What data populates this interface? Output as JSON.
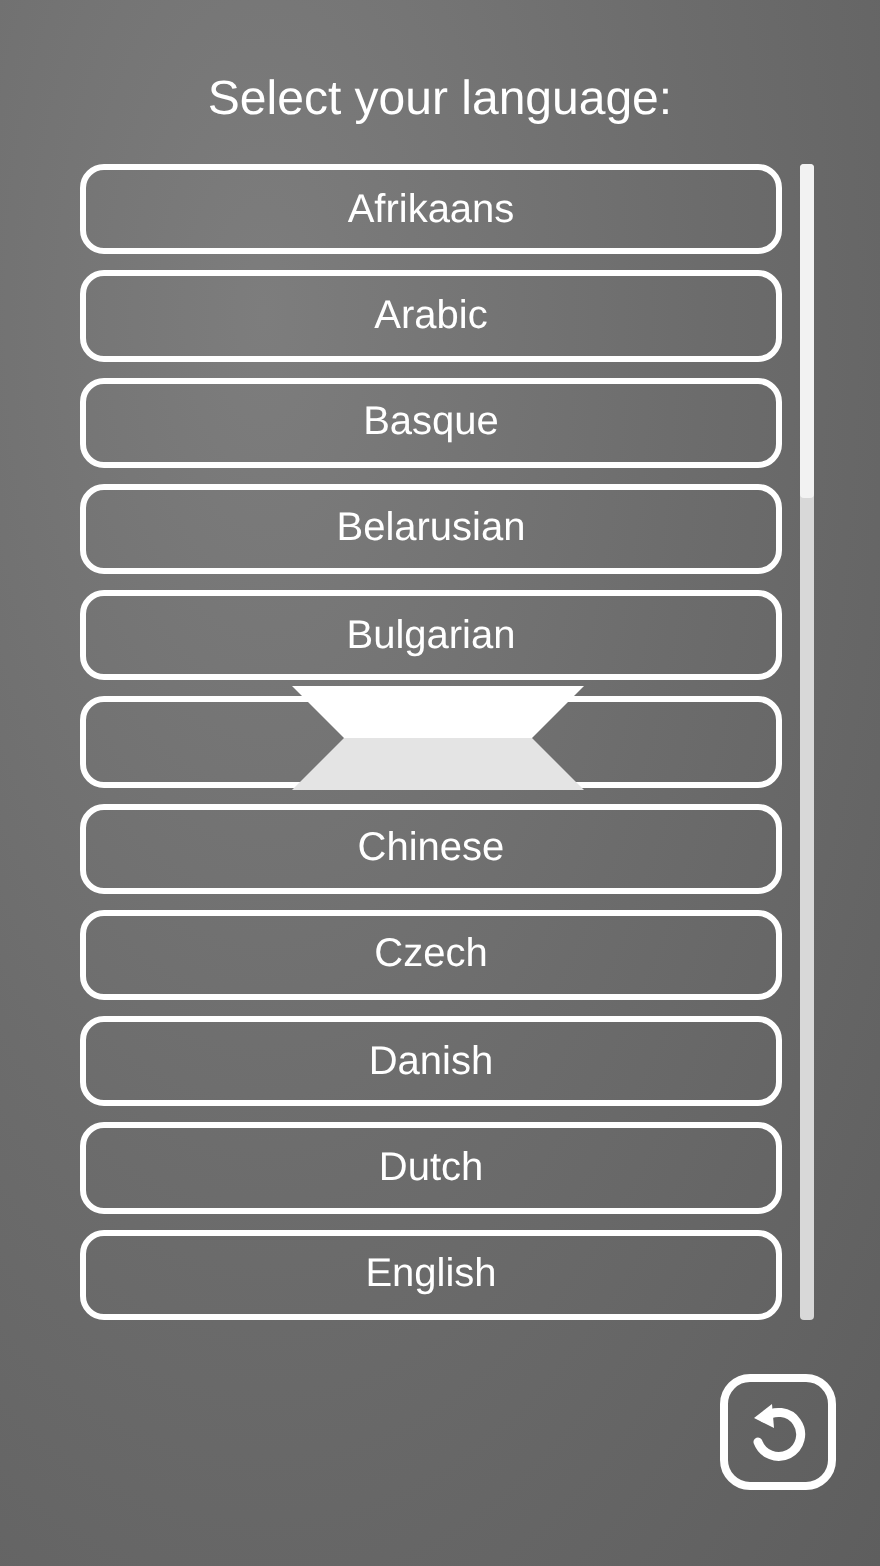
{
  "title": "Select your language:",
  "languages": [
    {
      "kind": "label",
      "label": "Afrikaans"
    },
    {
      "kind": "label",
      "label": "Arabic"
    },
    {
      "kind": "label",
      "label": "Basque"
    },
    {
      "kind": "label",
      "label": "Belarusian"
    },
    {
      "kind": "label",
      "label": "Bulgarian"
    },
    {
      "kind": "blank"
    },
    {
      "kind": "label",
      "label": "Chinese"
    },
    {
      "kind": "label",
      "label": "Czech"
    },
    {
      "kind": "label",
      "label": "Danish"
    },
    {
      "kind": "label",
      "label": "Dutch"
    },
    {
      "kind": "label",
      "label": "English"
    }
  ]
}
